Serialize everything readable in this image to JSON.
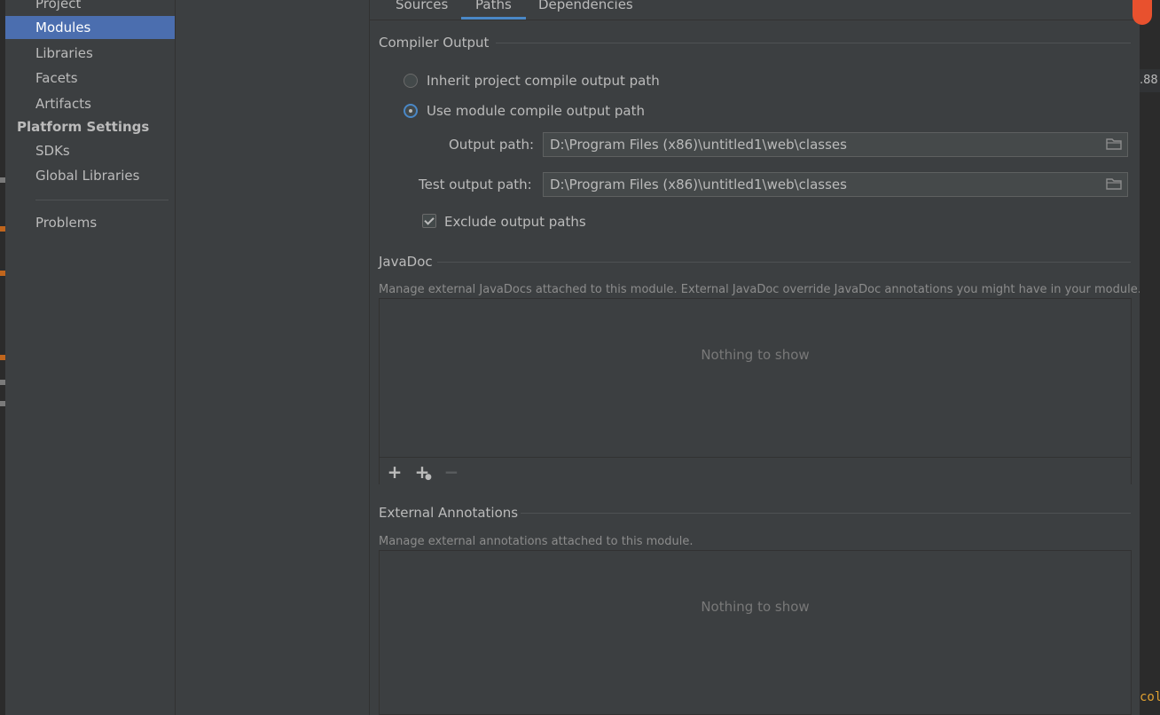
{
  "sidebar": {
    "items": [
      {
        "label": "Project"
      },
      {
        "label": "Modules"
      },
      {
        "label": "Libraries"
      },
      {
        "label": "Facets"
      },
      {
        "label": "Artifacts"
      }
    ],
    "platform_header": "Platform Settings",
    "platform_items": [
      {
        "label": "SDKs"
      },
      {
        "label": "Global Libraries"
      }
    ],
    "problems": "Problems"
  },
  "tabs": [
    {
      "label": "Sources"
    },
    {
      "label": "Paths"
    },
    {
      "label": "Dependencies"
    }
  ],
  "compiler_output": {
    "title": "Compiler Output",
    "inherit_label": "Inherit project compile output path",
    "use_module_label": "Use module compile output path",
    "output_path_label": "Output path:",
    "output_path_value": "D:\\Program Files (x86)\\untitled1\\web\\classes",
    "test_output_path_label": "Test output path:",
    "test_output_path_value": "D:\\Program Files (x86)\\untitled1\\web\\classes",
    "exclude_label": "Exclude output paths"
  },
  "javadoc": {
    "title": "JavaDoc",
    "description": "Manage external JavaDocs attached to this module. External JavaDoc override JavaDoc annotations you might have in your module.",
    "empty": "Nothing to show"
  },
  "external_annotations": {
    "title": "External Annotations",
    "description": "Manage external annotations attached to this module.",
    "empty": "Nothing to show"
  },
  "right_strip": {
    "text_top": ".88",
    "text_bottom": "col"
  },
  "colors": {
    "background": "#3c3f41",
    "selection": "#4b6eaf",
    "accent": "#4a88c7",
    "text": "#bbbbbb"
  },
  "icons": {
    "folder": "folder-icon",
    "add": "plus-icon",
    "add_web": "add-web-link-icon",
    "remove": "minus-icon"
  }
}
